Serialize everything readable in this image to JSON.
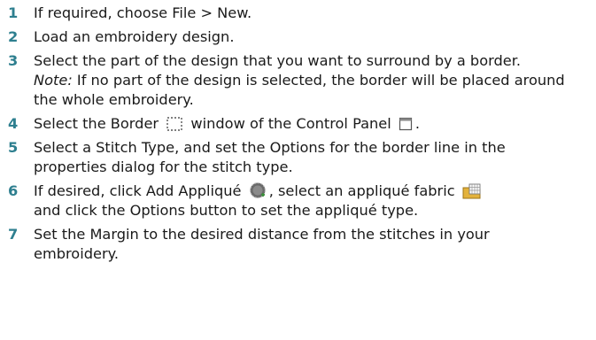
{
  "steps": [
    {
      "num": "1",
      "text": "If required, choose File > New."
    },
    {
      "num": "2",
      "text": "Load an embroidery design."
    },
    {
      "num": "3",
      "text": "Select the part of the design that you want to surround by a border.",
      "note_label": "Note:",
      "note_text": " If no part of the design is selected, the border will be placed around the whole embroidery."
    },
    {
      "num": "4",
      "text_a": "Select the Border",
      "text_b": "window of the Control Panel",
      "text_c": "."
    },
    {
      "num": "5",
      "text": "Select a Stitch Type, and set the Options for the border line in the properties dialog for the stitch type."
    },
    {
      "num": "6",
      "text_a": "If desired, click Add Appliqué",
      "text_b": ", select an appliqué fabric",
      "text_c": "and click the Options button to set the appliqué type."
    },
    {
      "num": "7",
      "text": "Set the Margin to the desired distance from the stitches in your embroidery."
    }
  ],
  "icons": {
    "border": "border-icon",
    "control_panel": "control-panel-icon",
    "add_applique": "add-applique-icon",
    "applique_fabric": "applique-fabric-icon"
  },
  "colors": {
    "step_number": "#2e7f8f",
    "text": "#1a1a1a"
  }
}
